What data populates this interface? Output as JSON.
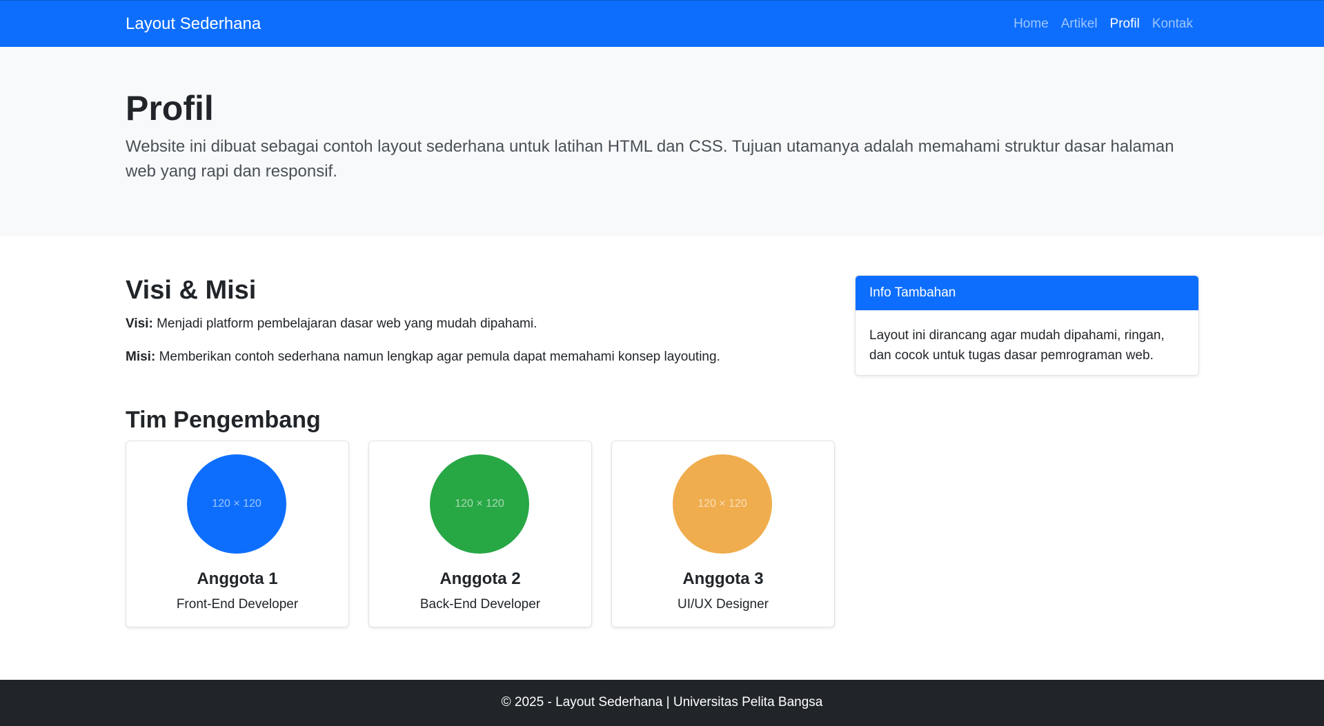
{
  "navbar": {
    "brand": "Layout Sederhana",
    "links": [
      "Home",
      "Artikel",
      "Profil",
      "Kontak"
    ],
    "active": "Profil"
  },
  "hero": {
    "title": "Profil",
    "lead": "Website ini dibuat sebagai contoh layout sederhana untuk latihan HTML dan CSS. Tujuan utamanya adalah memahami struktur dasar halaman web yang rapi dan responsif."
  },
  "visi_misi": {
    "heading": "Visi & Misi",
    "visi_label": "Visi:",
    "visi_text": "Menjadi platform pembelajaran dasar web yang mudah dipahami.",
    "misi_label": "Misi:",
    "misi_text": "Memberikan contoh sederhana namun lengkap agar pemula dapat memahami konsep layouting."
  },
  "info": {
    "header": "Info Tambahan",
    "body": "Layout ini dirancang agar mudah dipahami, ringan, dan cocok untuk tugas dasar pemrograman web."
  },
  "team": {
    "heading": "Tim Pengembang",
    "members": [
      {
        "name": "Anggota 1",
        "role": "Front-End Developer",
        "placeholder": "120 × 120",
        "color": "#0d6efd"
      },
      {
        "name": "Anggota 2",
        "role": "Back-End Developer",
        "placeholder": "120 × 120",
        "color": "#28a745"
      },
      {
        "name": "Anggota 3",
        "role": "UI/UX Designer",
        "placeholder": "120 × 120",
        "color": "#f0ad4e"
      }
    ]
  },
  "footer": {
    "text": "© 2025 - Layout Sederhana | Universitas Pelita Bangsa"
  }
}
